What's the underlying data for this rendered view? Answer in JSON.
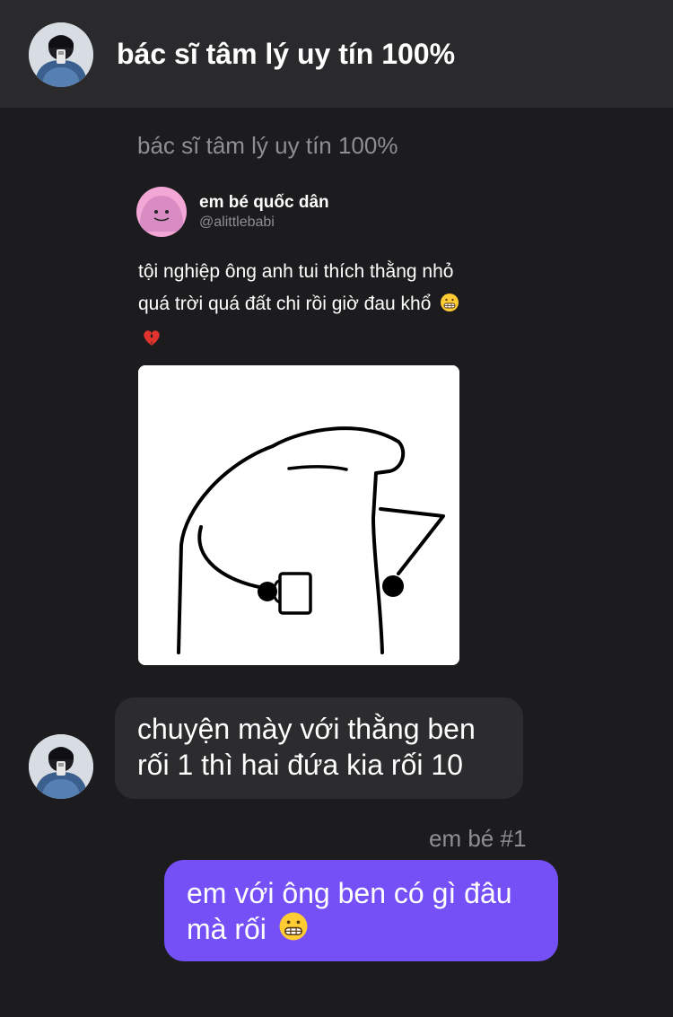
{
  "header": {
    "title": "bác sĩ tâm lý uy tín 100%",
    "avatar_icon": "profile-avatar-icon"
  },
  "messages": [
    {
      "sender": "bác sĩ tâm lý uy tín 100%",
      "type": "shared-post",
      "post": {
        "author_name": "em bé quốc dân",
        "author_handle": "@alittlebabi",
        "text": "tội nghiệp ông anh tui thích thằng nhỏ quá trời quá đất chi rồi giờ đau khổ",
        "emojis": [
          "grimacing-face-emoji",
          "broken-heart-emoji"
        ],
        "image_icon": "flork-meme-drawing"
      }
    },
    {
      "type": "text",
      "direction": "incoming",
      "text": "chuyện mày với thằng ben rối 1 thì hai đứa kia rối 10"
    },
    {
      "sender": "em bé #1",
      "type": "text",
      "direction": "outgoing",
      "text": "em với ông ben có gì đâu mà rối",
      "emojis": [
        "grimacing-face-emoji"
      ]
    }
  ],
  "colors": {
    "background": "#1c1c1e",
    "header": "#2a2a2c",
    "incoming_bubble": "#2c2c2e",
    "outgoing_bubble": "#7550f7",
    "secondary_text": "#8e8e93"
  }
}
